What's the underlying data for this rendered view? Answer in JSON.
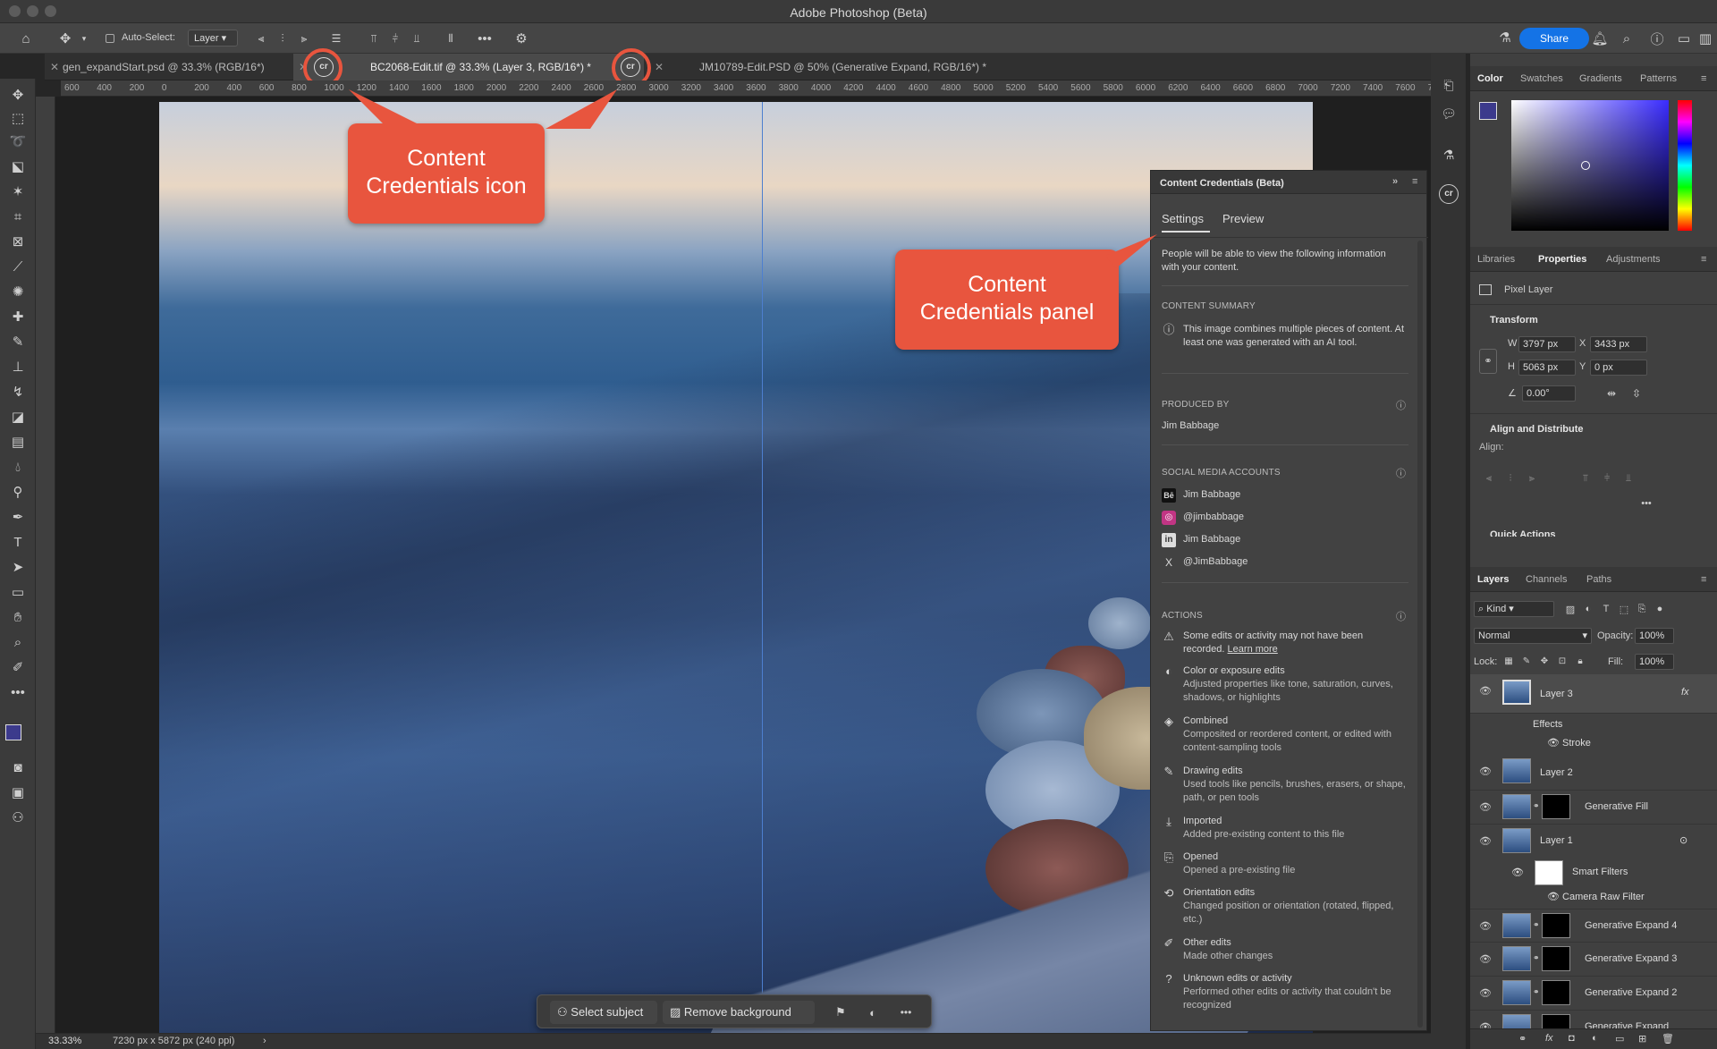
{
  "app": {
    "title": "Adobe Photoshop (Beta)"
  },
  "options_bar": {
    "auto_select_label": "Auto-Select:",
    "auto_select_value": "Layer",
    "share_label": "Share"
  },
  "tabs": [
    {
      "label": "gen_expandStart.psd @ 33.3% (RGB/16*)"
    },
    {
      "label": "BC2068-Edit.tif @ 33.3% (Layer 3, RGB/16*) *"
    },
    {
      "label": "JM10789-Edit.PSD @ 50% (Generative Expand, RGB/16*) *"
    }
  ],
  "ruler_ticks": [
    "600",
    "400",
    "200",
    "0",
    "200",
    "400",
    "600",
    "800",
    "1000",
    "1200",
    "1400",
    "1600",
    "1800",
    "2000",
    "2200",
    "2400",
    "2600",
    "2800",
    "3000",
    "3200",
    "3400",
    "3600",
    "3800",
    "4000",
    "4200",
    "4400",
    "4600",
    "4800",
    "5000",
    "5200",
    "5400",
    "5600",
    "5800",
    "6000",
    "6200",
    "6400",
    "6600",
    "6800",
    "7000",
    "7200",
    "7400",
    "7600",
    "71"
  ],
  "annotations": {
    "icon_callout": "Content\nCredentials icon",
    "panel_callout": "Content\nCredentials panel"
  },
  "context_bar": {
    "select_subject": "Select subject",
    "remove_background": "Remove background"
  },
  "status": {
    "zoom": "33.33%",
    "doc_info": "7230 px x 5872 px (240 ppi)"
  },
  "cc_panel": {
    "title": "Content Credentials (Beta)",
    "tab_settings": "Settings",
    "tab_preview": "Preview",
    "intro": "People will be able to view the following information with your content.",
    "summary_heading": "CONTENT SUMMARY",
    "summary_text": "This image combines multiple pieces of content. At least one was generated with an AI tool.",
    "produced_heading": "PRODUCED BY",
    "produced_name": "Jim Babbage",
    "social_heading": "SOCIAL MEDIA ACCOUNTS",
    "social": [
      {
        "icon": "Bē",
        "name": "Jim Babbage"
      },
      {
        "icon": "◎",
        "name": "@jimbabbage"
      },
      {
        "icon": "in",
        "name": "Jim Babbage"
      },
      {
        "icon": "X",
        "name": "@JimBabbage"
      }
    ],
    "actions_heading": "ACTIONS",
    "warning_text": "Some edits or activity may not have been recorded.",
    "learn_more": "Learn more",
    "actions": [
      {
        "icon": "◐",
        "title": "Color or exposure edits",
        "desc": "Adjusted properties like tone, saturation, curves, shadows, or highlights"
      },
      {
        "icon": "◈",
        "title": "Combined",
        "desc": "Composited or reordered content, or edited with content-sampling tools"
      },
      {
        "icon": "✎",
        "title": "Drawing edits",
        "desc": "Used tools like pencils, brushes, erasers, or shape, path, or pen tools"
      },
      {
        "icon": "⤓",
        "title": "Imported",
        "desc": "Added pre-existing content to this file"
      },
      {
        "icon": "⎘",
        "title": "Opened",
        "desc": "Opened a pre-existing file"
      },
      {
        "icon": "⟲",
        "title": "Orientation edits",
        "desc": "Changed position or orientation (rotated, flipped, etc.)"
      },
      {
        "icon": "✐",
        "title": "Other edits",
        "desc": "Made other changes"
      },
      {
        "icon": "?",
        "title": "Unknown edits or activity",
        "desc": "Performed other edits or activity that couldn't be recognized"
      }
    ]
  },
  "color_panel": {
    "tabs": [
      "Color",
      "Swatches",
      "Gradients",
      "Patterns"
    ],
    "fg_color": "#3c3a8c"
  },
  "properties_panel": {
    "tabs": [
      "Libraries",
      "Properties",
      "Adjustments"
    ],
    "layer_type": "Pixel Layer",
    "transform_heading": "Transform",
    "w_label": "W",
    "w_value": "3797 px",
    "h_label": "H",
    "h_value": "5063 px",
    "x_label": "X",
    "x_value": "3433 px",
    "y_label": "Y",
    "y_value": "0 px",
    "angle_value": "0.00°",
    "align_heading": "Align and Distribute",
    "align_label": "Align:",
    "quick_actions": "Quick Actions"
  },
  "layers_panel": {
    "tabs": [
      "Layers",
      "Channels",
      "Paths"
    ],
    "filter_kind": "Kind",
    "blend_mode": "Normal",
    "opacity_label": "Opacity:",
    "opacity_value": "100%",
    "lock_label": "Lock:",
    "fill_label": "Fill:",
    "fill_value": "100%",
    "layers": [
      {
        "name": "Layer 3",
        "has_mask": false
      },
      {
        "name": "Layer 2",
        "has_mask": false
      },
      {
        "name": "Generative Fill",
        "has_mask": true
      },
      {
        "name": "Layer 1",
        "has_mask": false
      },
      {
        "name": "Generative Expand 4",
        "has_mask": true
      },
      {
        "name": "Generative Expand 3",
        "has_mask": true
      },
      {
        "name": "Generative Expand 2",
        "has_mask": true
      }
    ],
    "effects_label": "Effects",
    "stroke_label": "Stroke",
    "smart_filters_label": "Smart Filters",
    "camera_raw_label": "Camera Raw Filter",
    "partial_layer": "Generative Expand"
  }
}
